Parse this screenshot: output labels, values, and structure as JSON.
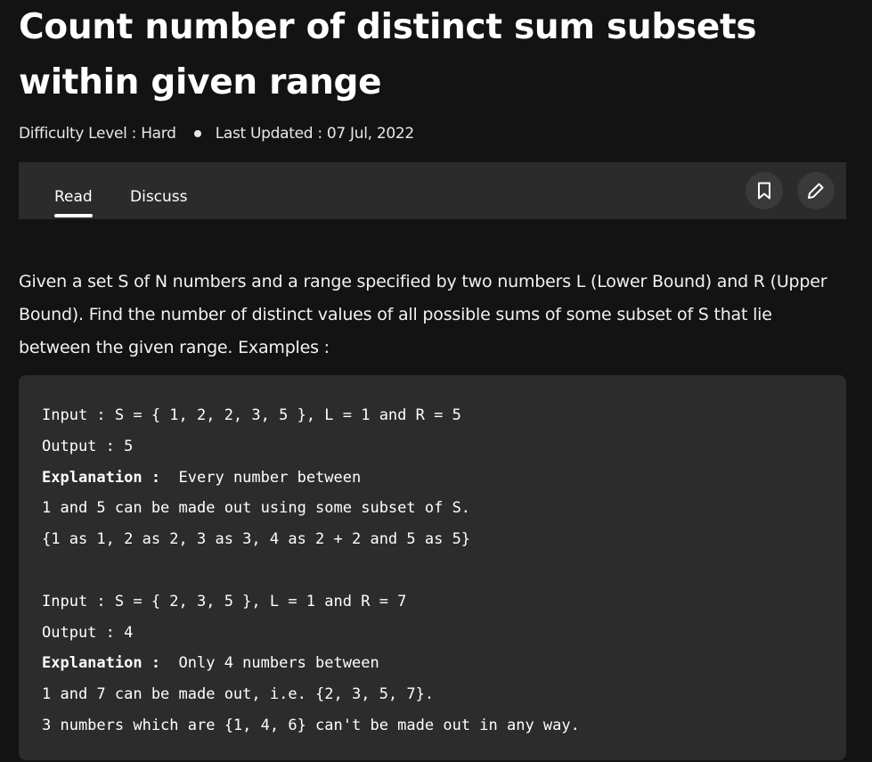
{
  "article": {
    "title": "Count number of distinct sum subsets within given range",
    "difficulty": "Difficulty Level : Hard",
    "updated": "Last Updated : 07 Jul, 2022"
  },
  "tabs": {
    "read": "Read",
    "discuss": "Discuss"
  },
  "toolbar": {
    "bookmark_icon": "bookmark-icon",
    "edit_icon": "pencil-icon"
  },
  "description": "Given a set S of N numbers and a range specified by two numbers L (Lower Bound) and R (Upper Bound). Find the number of distinct values of all possible sums of some subset of S that lie between the given range. Examples :",
  "code": {
    "ex1_input": "Input : S = { 1, 2, 2, 3, 5 }, L = 1 and R = 5",
    "ex1_output": "Output : 5",
    "ex1_expl_label": "Explanation :",
    "ex1_expl_text": "  Every number between",
    "ex1_line2": "1 and 5 can be made out using some subset of S.",
    "ex1_line3": "{1 as 1, 2 as 2, 3 as 3, 4 as 2 + 2 and 5 as 5}",
    "ex2_input": "Input : S = { 2, 3, 5 }, L = 1 and R = 7",
    "ex2_output": "Output : 4",
    "ex2_expl_label": "Explanation :",
    "ex2_expl_text": "  Only 4 numbers between",
    "ex2_line2": "1 and 7 can be made out, i.e. {2, 3, 5, 7}.",
    "ex2_line3": "3 numbers which are {1, 4, 6} can't be made out in any way."
  }
}
